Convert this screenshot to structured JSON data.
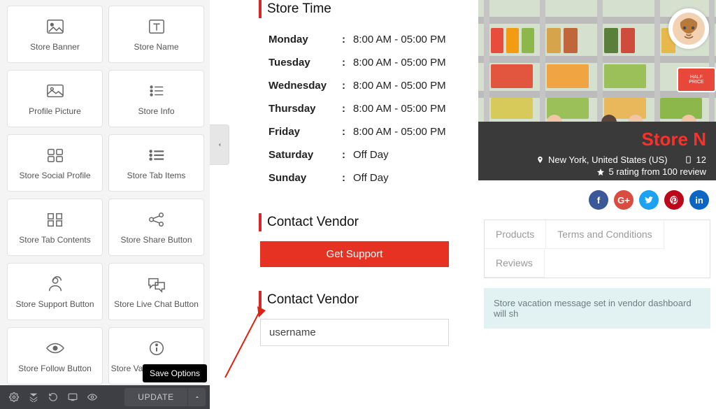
{
  "sidebar": {
    "widgets": [
      {
        "label": "Store Banner",
        "icon": "image-icon"
      },
      {
        "label": "Store Name",
        "icon": "text-icon"
      },
      {
        "label": "Profile Picture",
        "icon": "picture-icon"
      },
      {
        "label": "Store Info",
        "icon": "list-dots-icon"
      },
      {
        "label": "Store Social Profile",
        "icon": "grid-four-icon"
      },
      {
        "label": "Store Tab Items",
        "icon": "list-lines-icon"
      },
      {
        "label": "Store Tab Contents",
        "icon": "grid-squares-icon"
      },
      {
        "label": "Store Share Button",
        "icon": "share-icon"
      },
      {
        "label": "Store Support Button",
        "icon": "person-icon"
      },
      {
        "label": "Store Live Chat Button",
        "icon": "chat-icon"
      },
      {
        "label": "Store Follow Button",
        "icon": "eye-icon"
      },
      {
        "label": "Store Vacation Message",
        "icon": "info-icon"
      }
    ]
  },
  "footer": {
    "update_label": "UPDATE",
    "save_options_tooltip": "Save Options"
  },
  "store_time": {
    "title": "Store Time",
    "days": [
      {
        "day": "Monday",
        "time": "8:00 AM - 05:00 PM"
      },
      {
        "day": "Tuesday",
        "time": "8:00 AM - 05:00 PM"
      },
      {
        "day": "Wednesday",
        "time": "8:00 AM - 05:00 PM"
      },
      {
        "day": "Thursday",
        "time": "8:00 AM - 05:00 PM"
      },
      {
        "day": "Friday",
        "time": "8:00 AM - 05:00 PM"
      },
      {
        "day": "Saturday",
        "time": "Off Day"
      },
      {
        "day": "Sunday",
        "time": "Off Day"
      }
    ]
  },
  "contact_vendor_support": {
    "title": "Contact Vendor",
    "button_label": "Get Support"
  },
  "contact_vendor_form": {
    "title": "Contact Vendor",
    "name_value": "username"
  },
  "preview": {
    "store_name": "Store N",
    "address": "New York, United States (US)",
    "phone_fragment": "12",
    "rating_line": " 5 rating from 100 review",
    "half_price": {
      "top": "HALF",
      "bottom": "PRICE"
    },
    "tabs": [
      "Products",
      "Terms and Conditions",
      "Reviews"
    ],
    "vacation_notice": "Store vacation message set in vendor dashboard will sh"
  },
  "colors": {
    "accent_red": "#e63223",
    "dark_bar": "#3a3a3a"
  }
}
